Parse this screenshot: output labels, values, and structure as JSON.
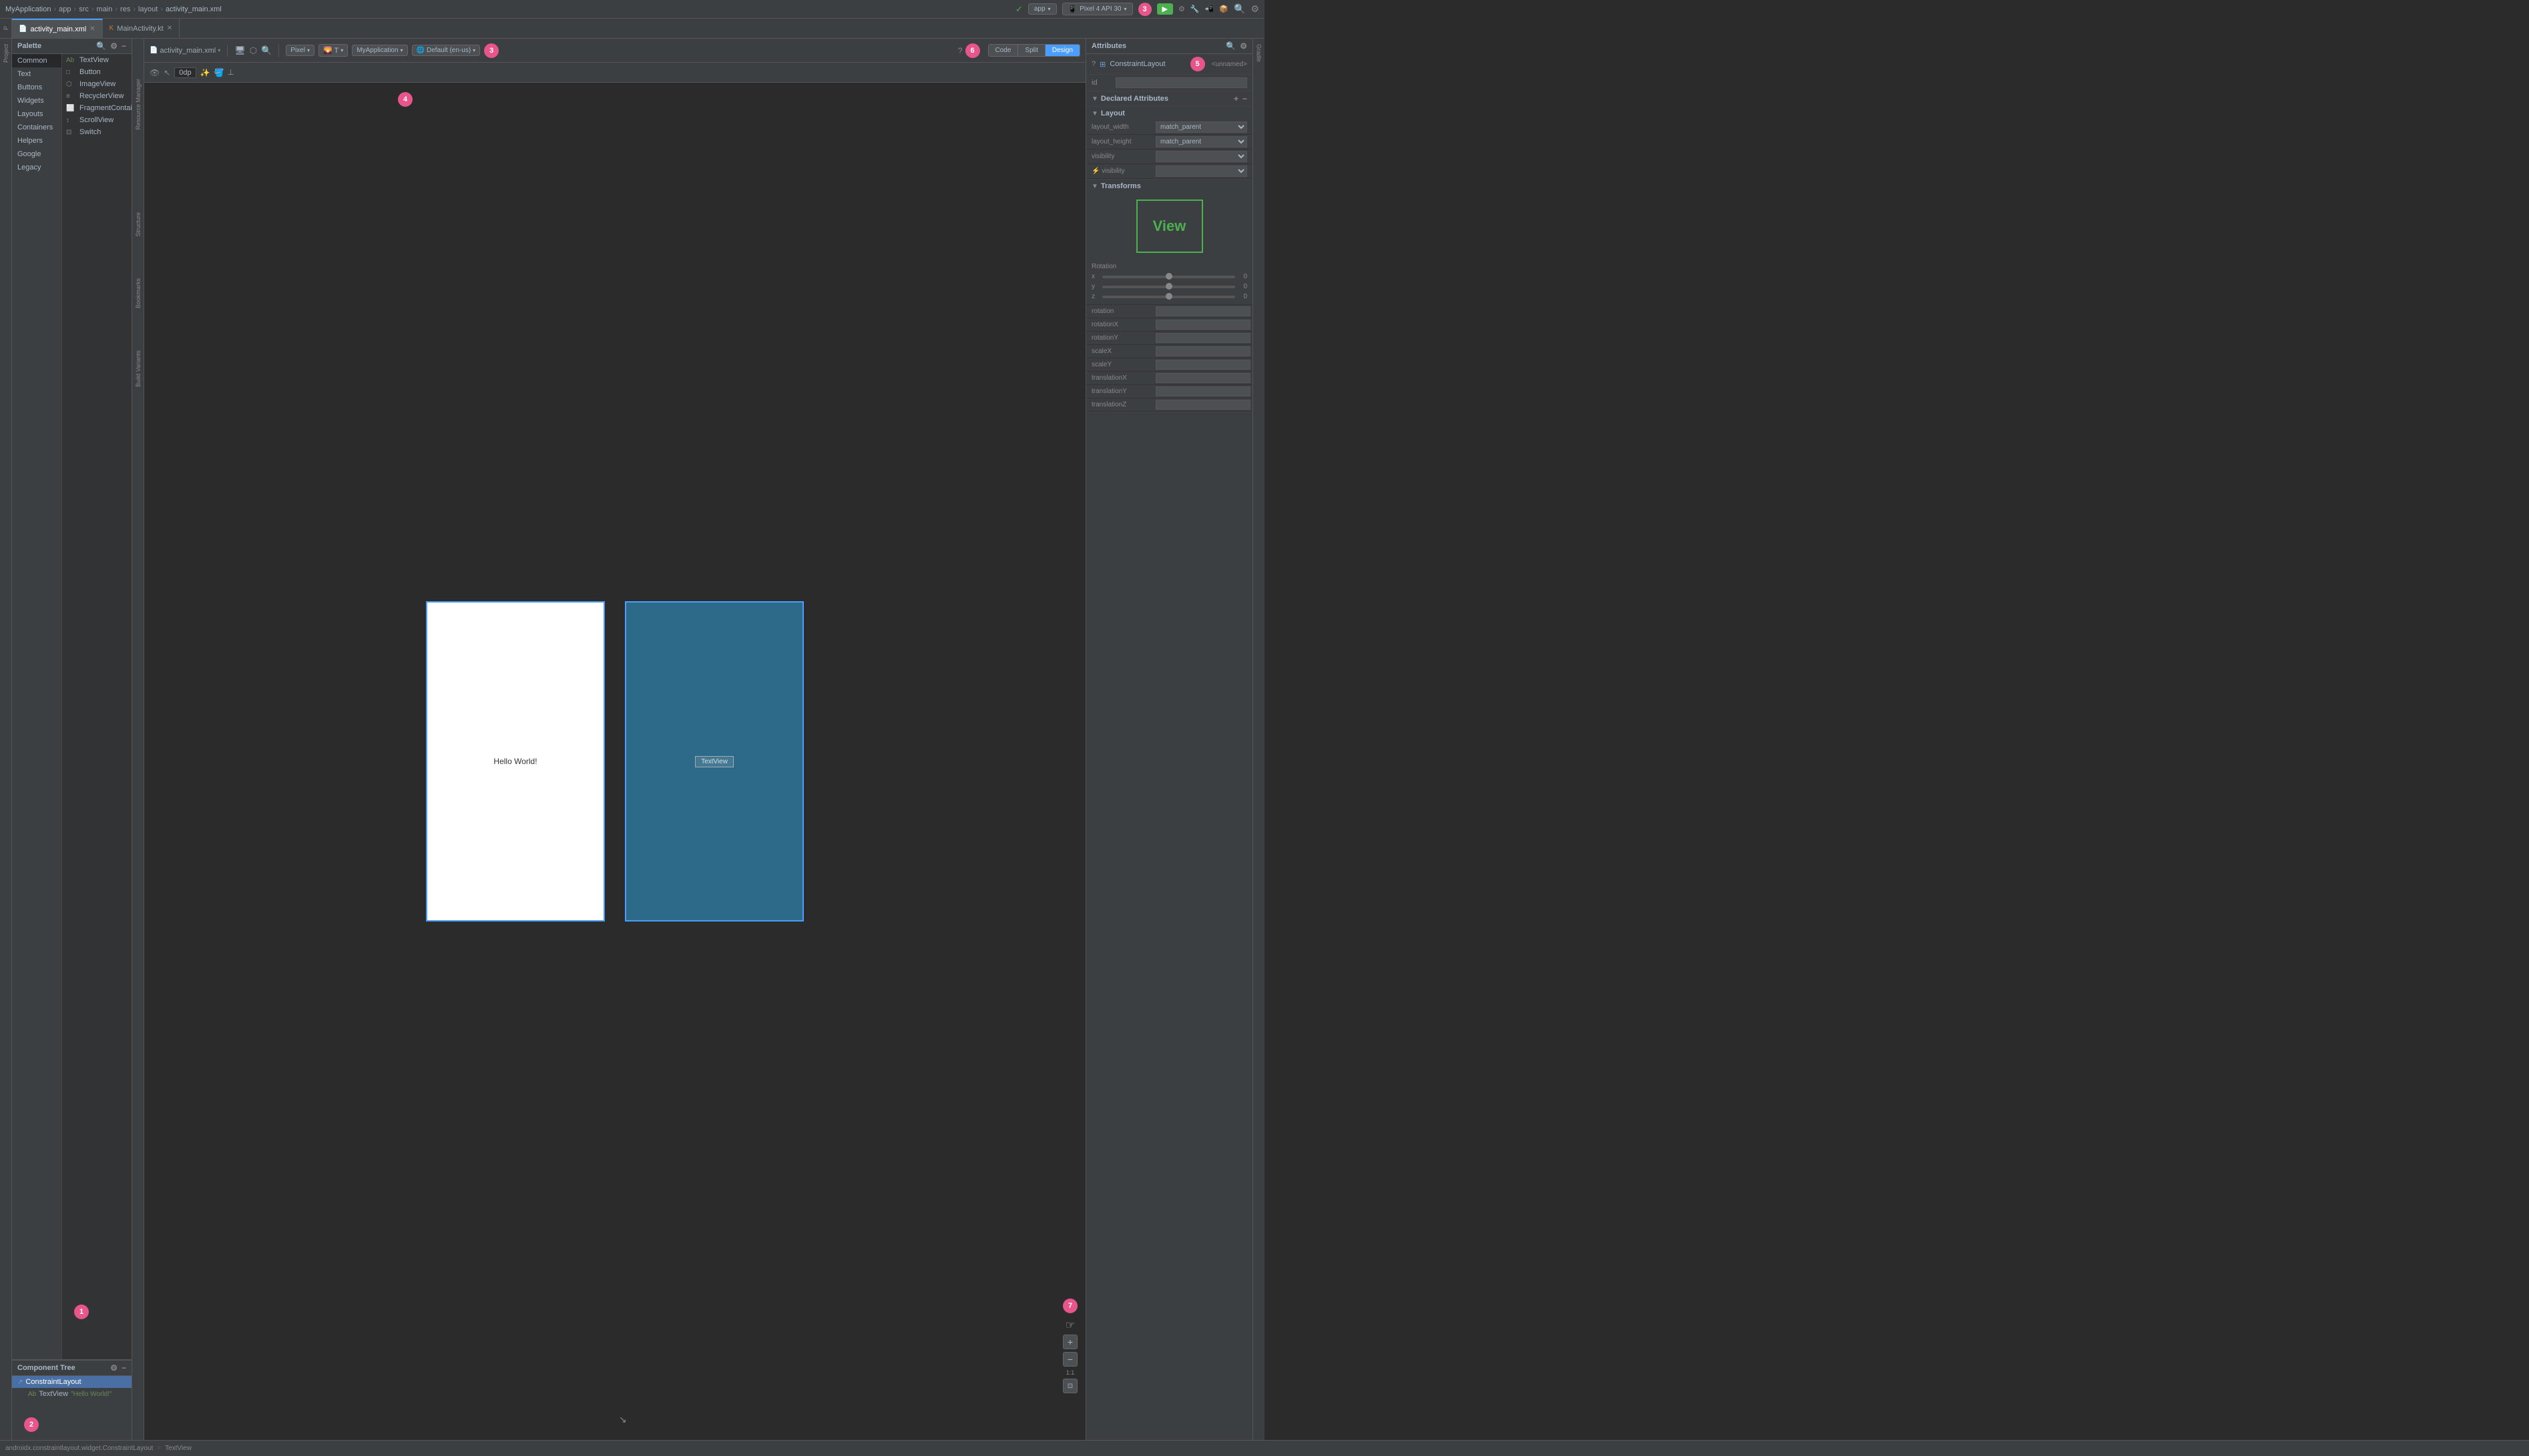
{
  "titlebar": {
    "breadcrumb": [
      "MyApplication",
      "app",
      "src",
      "main",
      "res",
      "layout",
      "activity_main.xml"
    ],
    "breadcrumb_seps": [
      ">",
      ">",
      ">",
      ">",
      ">",
      ">"
    ],
    "app_dropdown": "app",
    "device": "Pixel 4 API 30",
    "run_btn": "▶"
  },
  "tabs": [
    {
      "label": "activity_main.xml",
      "active": true,
      "icon": "xml-icon"
    },
    {
      "label": "MainActivity.kt",
      "active": false,
      "icon": "kt-icon"
    }
  ],
  "palette": {
    "title": "Palette",
    "categories": [
      {
        "label": "Common",
        "active": true
      },
      {
        "label": "Text"
      },
      {
        "label": "Buttons"
      },
      {
        "label": "Widgets"
      },
      {
        "label": "Layouts"
      },
      {
        "label": "Containers"
      },
      {
        "label": "Helpers"
      },
      {
        "label": "Google"
      },
      {
        "label": "Legacy"
      }
    ],
    "items": [
      {
        "label": "TextView",
        "icon": "Ab"
      },
      {
        "label": "Button",
        "icon": "□"
      },
      {
        "label": "ImageView",
        "icon": "⬡"
      },
      {
        "label": "RecyclerView",
        "icon": "≡"
      },
      {
        "label": "FragmentContainerView",
        "icon": "⬜"
      },
      {
        "label": "ScrollView",
        "icon": "↕"
      },
      {
        "label": "Switch",
        "icon": "⊡"
      }
    ]
  },
  "component_tree": {
    "title": "Component Tree",
    "items": [
      {
        "label": "ConstraintLayout",
        "icon": "↗",
        "indent": 0,
        "selected": false
      },
      {
        "label": "TextView",
        "icon": "Ab",
        "indent": 1,
        "selected": false,
        "value": "\"Hello World!\""
      }
    ]
  },
  "editor": {
    "file_label": "activity_main.xml",
    "margin_value": "0dp",
    "canvas": {
      "hello_world_text": "Hello World!",
      "textview_label": "TextView"
    }
  },
  "attributes": {
    "title": "Attributes",
    "component_name": "ConstraintLayout",
    "id_label": "id",
    "id_placeholder": "",
    "component_unnamed": "<unnamed>",
    "declared_attributes": "Declared Attributes",
    "layout_section": "Layout",
    "transforms_section": "Transforms",
    "layout_rows": [
      {
        "label": "layout_width",
        "value": "match_parent"
      },
      {
        "label": "layout_height",
        "value": "match_parent"
      },
      {
        "label": "visibility",
        "value": ""
      },
      {
        "label": "⚡ visibility",
        "value": ""
      }
    ],
    "rotation_section": "Rotation",
    "rotation_rows": [
      {
        "axis": "x",
        "value": "0"
      },
      {
        "axis": "y",
        "value": "0"
      },
      {
        "axis": "z",
        "value": "0"
      }
    ],
    "field_rows": [
      {
        "label": "rotation",
        "value": ""
      },
      {
        "label": "rotationX",
        "value": ""
      },
      {
        "label": "rotationY",
        "value": ""
      },
      {
        "label": "scaleX",
        "value": ""
      },
      {
        "label": "scaleY",
        "value": ""
      },
      {
        "label": "translationX",
        "value": ""
      },
      {
        "label": "translationY",
        "value": ""
      },
      {
        "label": "translationZ",
        "value": ""
      }
    ],
    "view_preview_text": "View"
  },
  "numbers": {
    "badge_1": "1",
    "badge_2": "2",
    "badge_3": "3",
    "badge_4": "4",
    "badge_6": "6",
    "badge_7": "7"
  },
  "statusbar": {
    "class": "androidx.constraintlayout.widget.ConstraintLayout",
    "sep": ">",
    "element": "TextView"
  },
  "view_modes": {
    "code": "Code",
    "split": "Split",
    "design": "Design"
  }
}
